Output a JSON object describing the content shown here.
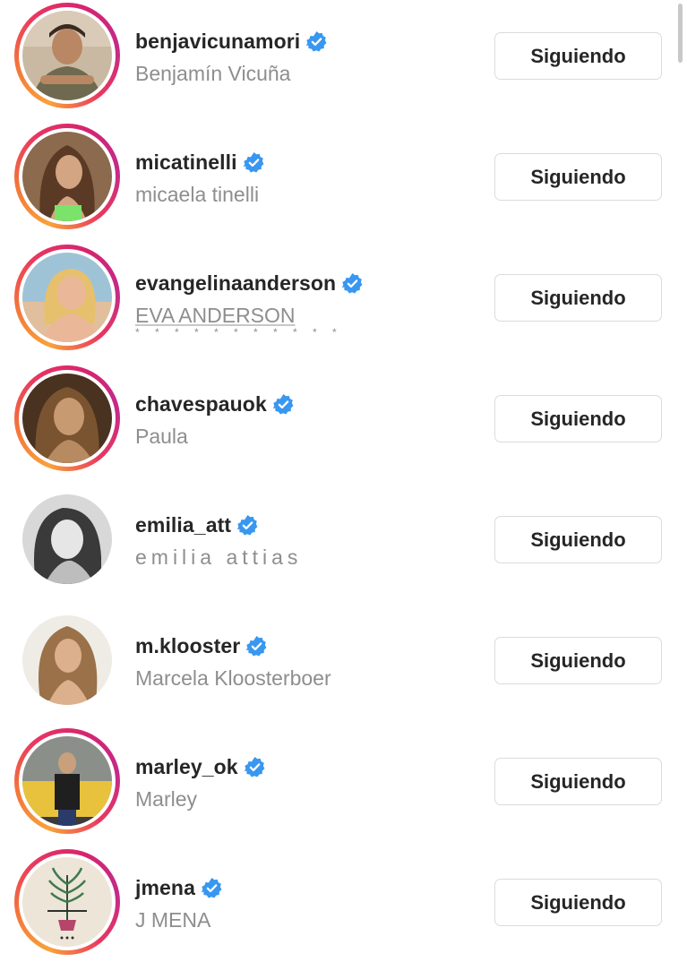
{
  "following": [
    {
      "username": "benjavicunamori",
      "full_name": "Benjamín Vicuña",
      "verified": true,
      "story_ring": true,
      "button_label": "Siguiendo",
      "avatar": "man-smiling-photo"
    },
    {
      "username": "micatinelli",
      "full_name": "micaela tinelli",
      "verified": true,
      "story_ring": true,
      "button_label": "Siguiendo",
      "avatar": "woman-long-hair-photo"
    },
    {
      "username": "evangelinaanderson",
      "full_name": "EVA ANDERSON",
      "extra_text": "* * *  * * * * * * * *",
      "verified": true,
      "story_ring": true,
      "button_label": "Siguiendo",
      "avatar": "blonde-woman-photo"
    },
    {
      "username": "chavespauok",
      "full_name": "Paula",
      "verified": true,
      "story_ring": true,
      "button_label": "Siguiendo",
      "avatar": "woman-portrait-photo"
    },
    {
      "username": "emilia_att",
      "full_name": "emilia attias",
      "verified": true,
      "story_ring": false,
      "button_label": "Siguiendo",
      "avatar": "bw-woman-photo"
    },
    {
      "username": "m.klooster",
      "full_name": "Marcela Kloosterboer",
      "verified": true,
      "story_ring": false,
      "button_label": "Siguiendo",
      "avatar": "curly-hair-woman-photo"
    },
    {
      "username": "marley_ok",
      "full_name": "Marley",
      "verified": true,
      "story_ring": true,
      "button_label": "Siguiendo",
      "avatar": "man-taxi-photo"
    },
    {
      "username": "jmena",
      "full_name": "J MENA",
      "verified": true,
      "story_ring": true,
      "button_label": "Siguiendo",
      "avatar": "plant-logo"
    }
  ],
  "colors": {
    "verified_blue": "#3897f0",
    "text_primary": "#262626",
    "text_secondary": "#8e8e8e",
    "button_border": "#dbdbdb"
  }
}
